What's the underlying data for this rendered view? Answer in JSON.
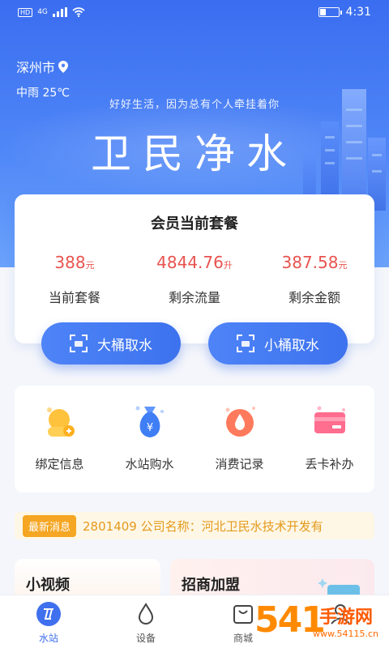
{
  "status_bar": {
    "network": "4G",
    "time": "4:31"
  },
  "location": {
    "city": "深州市",
    "weather": "中雨 25℃"
  },
  "hero": {
    "slogan": "好好生活，因为总有个人牵挂着你",
    "brand": "卫民净水"
  },
  "member_card": {
    "title": "会员当前套餐",
    "stats": [
      {
        "value": "388",
        "unit": "元",
        "label": "当前套餐"
      },
      {
        "value": "4844.76",
        "unit": "升",
        "label": "剩余流量"
      },
      {
        "value": "387.58",
        "unit": "元",
        "label": "剩余金额"
      }
    ]
  },
  "actions": {
    "big_bucket": "大桶取水",
    "small_bucket": "小桶取水"
  },
  "services": [
    {
      "label": "绑定信息",
      "icon": "user-bind-icon"
    },
    {
      "label": "水站购水",
      "icon": "money-bag-icon"
    },
    {
      "label": "消费记录",
      "icon": "water-drop-icon"
    },
    {
      "label": "丢卡补办",
      "icon": "card-icon"
    }
  ],
  "news": {
    "tag": "最新消息",
    "text": "2801409 公司名称：河北卫民水技术开发有"
  },
  "panels": {
    "video": "小视频",
    "franchise": "招商加盟"
  },
  "tabbar": [
    {
      "label": "水站",
      "icon": "water-station-icon",
      "active": true
    },
    {
      "label": "设备",
      "icon": "device-drop-icon",
      "active": false
    },
    {
      "label": "商城",
      "icon": "shop-bag-icon",
      "active": false
    },
    {
      "label": "",
      "icon": "profile-icon",
      "active": false
    }
  ],
  "watermark": {
    "text": "手游网",
    "domain": "www.54115.cn",
    "number": "541"
  },
  "colors": {
    "primary": "#3f70ee",
    "accent_red": "#e8534f",
    "news_orange": "#f5a623"
  }
}
